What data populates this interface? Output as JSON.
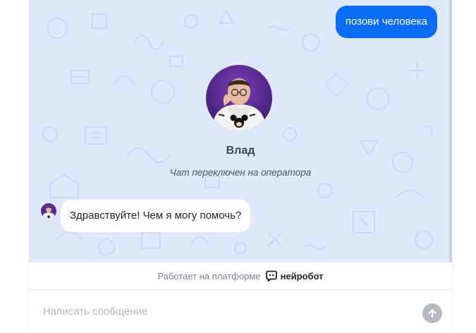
{
  "colors": {
    "chat_background": "#dde9fb",
    "user_bubble": "#0a6cf5",
    "operator_bubble": "#ffffff",
    "send_button": "#b5bac1"
  },
  "messages": {
    "user_message": "позови человека",
    "operator_message": "Здравствуйте! Чем я могу помочь?"
  },
  "operator": {
    "name": "Влад",
    "status_text": "Чат переключен на оператора",
    "avatar_icon": "person-avatar"
  },
  "footer": {
    "powered_by": "Работает на платформе",
    "brand_name": "нейробот",
    "brand_icon": "chat-bot-icon"
  },
  "composer": {
    "placeholder": "Написать сообщение",
    "value": "",
    "send_icon": "arrow-up-icon"
  }
}
